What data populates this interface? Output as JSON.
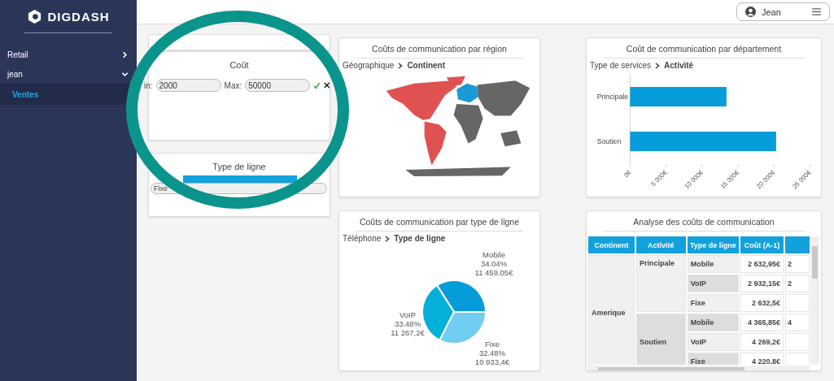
{
  "sidebar": {
    "logo": "DIGDASH",
    "items": [
      {
        "label": "Retail",
        "expanded": false
      },
      {
        "label": "jean",
        "expanded": true,
        "children": [
          {
            "label": "Ventes",
            "selected": true
          }
        ]
      }
    ]
  },
  "user_menu": {
    "name": "Jean"
  },
  "cost_filter": {
    "title": "Coût",
    "min_label": "in:",
    "min_value": "2000",
    "max_label": "Max:",
    "max_value": "50000"
  },
  "line_type_filter": {
    "title": "Type de ligne",
    "options": [
      {
        "label": "Fixe"
      }
    ]
  },
  "region_card": {
    "title": "Coûts de communication par région",
    "breadcrumb": [
      "Géographique",
      "Continent"
    ]
  },
  "department_card": {
    "title": "Coût de communication par département",
    "breadcrumb": [
      "Type de services",
      "Activité"
    ],
    "chart_data": {
      "type": "bar",
      "orientation": "horizontal",
      "categories": [
        "Principale",
        "Soutien"
      ],
      "series": [
        {
          "color": "#069cd9",
          "values": [
            13400,
            20300
          ]
        }
      ],
      "xlim": [
        0,
        25000
      ],
      "xticks": [
        {
          "value": 0,
          "label": "0€"
        },
        {
          "value": 5000,
          "label": "5 000€"
        },
        {
          "value": 10000,
          "label": "10 000€"
        },
        {
          "value": 15000,
          "label": "15 000€"
        },
        {
          "value": 20000,
          "label": "20 000€"
        },
        {
          "value": 25000,
          "label": "25 000€"
        }
      ]
    }
  },
  "line_card": {
    "title": "Coûts de communication par type de ligne",
    "breadcrumb": [
      "Téléphone",
      "Type de ligne"
    ],
    "chart_data": {
      "type": "pie",
      "categories": [
        "Mobile",
        "VoIP",
        "Fixe"
      ],
      "values": [
        34.04,
        33.48,
        32.48
      ],
      "colors": [
        "#069cd9",
        "#05b0d8",
        "#71cdf2"
      ],
      "value_labels": [
        [
          "34.04%",
          "11 459,05€"
        ],
        [
          "33.48%",
          "11 267,2€"
        ],
        [
          "32.48%",
          "10 933,4€"
        ]
      ]
    }
  },
  "table_card": {
    "title": "Analyse des coûts de communication",
    "columns": [
      "Continent",
      "Activité",
      "Type de ligne",
      "Coût (A-1)"
    ],
    "groups": [
      {
        "continent": "Amerique",
        "activities": [
          {
            "name": "Principale",
            "rows": [
              {
                "type": "Mobile",
                "cost": "2 632,95€",
                "column_5": "2"
              },
              {
                "type": "VoIP",
                "cost": "2 932,15€",
                "column_5": "2"
              },
              {
                "type": "Fixe",
                "cost": "2 632,5€"
              }
            ]
          },
          {
            "name": "Soutien",
            "rows": [
              {
                "type": "Mobile",
                "cost": "4 365,85€",
                "column_5": "4"
              },
              {
                "type": "VoIP",
                "cost": "4 269,2€"
              },
              {
                "type": "Fixe",
                "cost": "4 220,8€"
              }
            ]
          }
        ]
      }
    ]
  }
}
